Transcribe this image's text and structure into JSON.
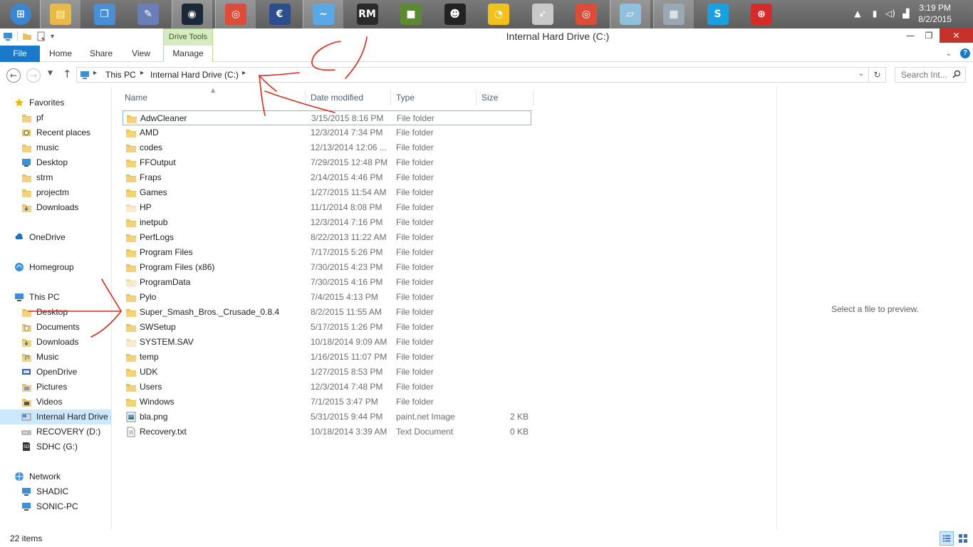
{
  "taskbar": {
    "apps": [
      {
        "name": "start",
        "icon": "windows-start-icon",
        "color": "#3b86d1"
      },
      {
        "name": "file-explorer",
        "icon": "file-explorer-icon",
        "color": "#e8b94a",
        "active": true
      },
      {
        "name": "app-blue",
        "icon": "window-stack-icon",
        "color": "#4a8fd6"
      },
      {
        "name": "paint-app",
        "icon": "paint-brush-icon",
        "color": "#6a7fb8"
      },
      {
        "name": "steam",
        "icon": "steam-icon",
        "color": "#1b2838",
        "active": true
      },
      {
        "name": "chrome",
        "icon": "chrome-icon",
        "color": "#dd4b39",
        "active": true
      },
      {
        "name": "ccleaner",
        "icon": "gear-e-icon",
        "color": "#2b4e8c"
      },
      {
        "name": "dolphin",
        "icon": "dolphin-icon",
        "color": "#5aa8e6",
        "active": true
      },
      {
        "name": "rpg-maker",
        "icon": "rm-icon",
        "color": "#2a2a2a"
      },
      {
        "name": "minecraft",
        "icon": "grass-block-icon",
        "color": "#5b8a32"
      },
      {
        "name": "face-app",
        "icon": "face-icon",
        "color": "#222222"
      },
      {
        "name": "pacman",
        "icon": "pacman-icon",
        "color": "#f2c21b"
      },
      {
        "name": "rocket-app",
        "icon": "rocket-icon",
        "color": "#c9c9c9"
      },
      {
        "name": "chrome-2",
        "icon": "chrome-icon",
        "color": "#dd4b39"
      },
      {
        "name": "app-cyan",
        "icon": "notepad-icon",
        "color": "#8fc1dc",
        "active": true
      },
      {
        "name": "resource-monitor",
        "icon": "monitor-chart-icon",
        "color": "#9aa7b4",
        "active": true
      },
      {
        "name": "skype",
        "icon": "skype-icon",
        "color": "#1a9fe0"
      },
      {
        "name": "smash",
        "icon": "smash-icon",
        "color": "#d62b2b"
      }
    ],
    "clock": {
      "time": "3:19 PM",
      "date": "8/2/2015"
    }
  },
  "window": {
    "title": "Internal Hard Drive (C:)",
    "contextual_group": "Drive Tools"
  },
  "ribbon": {
    "tabs": [
      {
        "label": "File"
      },
      {
        "label": "Home"
      },
      {
        "label": "Share"
      },
      {
        "label": "View"
      },
      {
        "label": "Manage"
      }
    ]
  },
  "address": {
    "segments": [
      "This PC",
      "Internal Hard Drive (C:)"
    ],
    "search_placeholder": "Search Int..."
  },
  "nav": {
    "items": [
      {
        "label": "Favorites",
        "icon": "star-icon",
        "level": 0
      },
      {
        "label": "pf",
        "icon": "folder-icon",
        "level": 1
      },
      {
        "label": "Recent places",
        "icon": "recent-places-icon",
        "level": 1
      },
      {
        "label": "music",
        "icon": "folder-icon",
        "level": 1
      },
      {
        "label": "Desktop",
        "icon": "desktop-icon",
        "level": 1
      },
      {
        "label": "strm",
        "icon": "folder-icon",
        "level": 1
      },
      {
        "label": "projectm",
        "icon": "folder-icon",
        "level": 1
      },
      {
        "label": "Downloads",
        "icon": "downloads-folder-icon",
        "level": 1
      },
      {
        "label": "OneDrive",
        "icon": "onedrive-icon",
        "level": 0
      },
      {
        "label": "Homegroup",
        "icon": "homegroup-icon",
        "level": 0
      },
      {
        "label": "This PC",
        "icon": "computer-icon",
        "level": 0
      },
      {
        "label": "Desktop",
        "icon": "folder-icon",
        "level": 1
      },
      {
        "label": "Documents",
        "icon": "documents-folder-icon",
        "level": 1
      },
      {
        "label": "Downloads",
        "icon": "downloads-folder-icon",
        "level": 1
      },
      {
        "label": "Music",
        "icon": "music-folder-icon",
        "level": 1
      },
      {
        "label": "OpenDrive",
        "icon": "opendrive-icon",
        "level": 1
      },
      {
        "label": "Pictures",
        "icon": "pictures-folder-icon",
        "level": 1
      },
      {
        "label": "Videos",
        "icon": "videos-folder-icon",
        "level": 1
      },
      {
        "label": "Internal Hard Drive (",
        "icon": "hard-drive-icon",
        "level": 1,
        "selected": true
      },
      {
        "label": "RECOVERY (D:)",
        "icon": "drive-icon",
        "level": 1
      },
      {
        "label": "SDHC (G:)",
        "icon": "sd-card-icon",
        "level": 1
      },
      {
        "label": "Network",
        "icon": "network-icon",
        "level": 0
      },
      {
        "label": "SHADIC",
        "icon": "computer-icon",
        "level": 1
      },
      {
        "label": "SONIC-PC",
        "icon": "computer-icon",
        "level": 1
      }
    ]
  },
  "columns": {
    "name": "Name",
    "date": "Date modified",
    "type": "Type",
    "size": "Size"
  },
  "files": [
    {
      "name": "AdwCleaner",
      "date": "3/15/2015 8:16 PM",
      "type": "File folder",
      "size": "",
      "icon": "folder"
    },
    {
      "name": "AMD",
      "date": "12/3/2014 7:34 PM",
      "type": "File folder",
      "size": "",
      "icon": "folder"
    },
    {
      "name": "codes",
      "date": "12/13/2014 12:06 ...",
      "type": "File folder",
      "size": "",
      "icon": "folder"
    },
    {
      "name": "FFOutput",
      "date": "7/29/2015 12:48 PM",
      "type": "File folder",
      "size": "",
      "icon": "folder"
    },
    {
      "name": "Fraps",
      "date": "2/14/2015 4:46 PM",
      "type": "File folder",
      "size": "",
      "icon": "folder"
    },
    {
      "name": "Games",
      "date": "1/27/2015 11:54 AM",
      "type": "File folder",
      "size": "",
      "icon": "folder"
    },
    {
      "name": "HP",
      "date": "11/1/2014 8:08 PM",
      "type": "File folder",
      "size": "",
      "icon": "folder-light"
    },
    {
      "name": "inetpub",
      "date": "12/3/2014 7:16 PM",
      "type": "File folder",
      "size": "",
      "icon": "folder"
    },
    {
      "name": "PerfLogs",
      "date": "8/22/2013 11:22 AM",
      "type": "File folder",
      "size": "",
      "icon": "folder"
    },
    {
      "name": "Program Files",
      "date": "7/17/2015 5:26 PM",
      "type": "File folder",
      "size": "",
      "icon": "folder"
    },
    {
      "name": "Program Files (x86)",
      "date": "7/30/2015 4:23 PM",
      "type": "File folder",
      "size": "",
      "icon": "folder"
    },
    {
      "name": "ProgramData",
      "date": "7/30/2015 4:16 PM",
      "type": "File folder",
      "size": "",
      "icon": "folder-light"
    },
    {
      "name": "Pylo",
      "date": "7/4/2015 4:13 PM",
      "type": "File folder",
      "size": "",
      "icon": "folder"
    },
    {
      "name": "Super_Smash_Bros._Crusade_0.8.4",
      "date": "8/2/2015 11:55 AM",
      "type": "File folder",
      "size": "",
      "icon": "folder"
    },
    {
      "name": "SWSetup",
      "date": "5/17/2015 1:26 PM",
      "type": "File folder",
      "size": "",
      "icon": "folder"
    },
    {
      "name": "SYSTEM.SAV",
      "date": "10/18/2014 9:09 AM",
      "type": "File folder",
      "size": "",
      "icon": "folder-light"
    },
    {
      "name": "temp",
      "date": "1/16/2015 11:07 PM",
      "type": "File folder",
      "size": "",
      "icon": "folder"
    },
    {
      "name": "UDK",
      "date": "1/27/2015 8:53 PM",
      "type": "File folder",
      "size": "",
      "icon": "folder"
    },
    {
      "name": "Users",
      "date": "12/3/2014 7:48 PM",
      "type": "File folder",
      "size": "",
      "icon": "folder"
    },
    {
      "name": "Windows",
      "date": "7/1/2015 3:47 PM",
      "type": "File folder",
      "size": "",
      "icon": "folder"
    },
    {
      "name": "bla.png",
      "date": "5/31/2015 9:44 PM",
      "type": "paint.net Image",
      "size": "2 KB",
      "icon": "image"
    },
    {
      "name": "Recovery.txt",
      "date": "10/18/2014 3:39 AM",
      "type": "Text Document",
      "size": "0 KB",
      "icon": "text"
    }
  ],
  "preview": {
    "message": "Select a file to preview."
  },
  "status": {
    "item_count": "22 items"
  },
  "colors": {
    "accent": "#1979ca",
    "selection": "#cce8ff",
    "folder": "#e8c25a",
    "annotation": "#e0251b"
  }
}
